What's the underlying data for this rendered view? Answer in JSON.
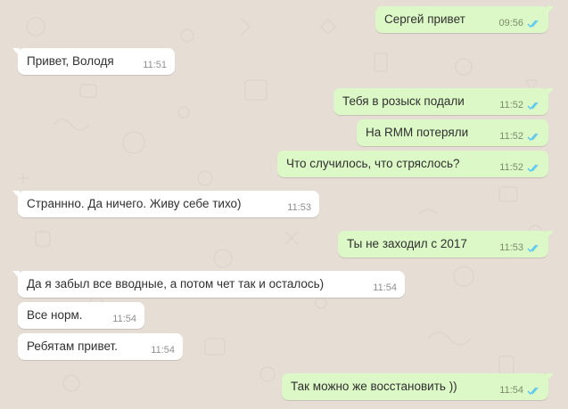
{
  "chat": {
    "messages": [
      {
        "direction": "out",
        "text": "Сергей привет",
        "time": "09:56",
        "status": "read-ticks-icon"
      },
      {
        "direction": "in",
        "text": "Привет, Володя",
        "time": "11:51"
      },
      {
        "direction": "out",
        "text": "Тебя в розыск подали",
        "time": "11:52",
        "status": "read-ticks-icon"
      },
      {
        "direction": "out",
        "text": "На RMM потеряли",
        "time": "11:52",
        "status": "read-ticks-icon"
      },
      {
        "direction": "out",
        "text": "Что случилось, что стряслось?",
        "time": "11:52",
        "status": "read-ticks-icon"
      },
      {
        "direction": "in",
        "text": "Страннно. Да ничего. Живу себе тихо)",
        "time": "11:53"
      },
      {
        "direction": "out",
        "text": "Ты не заходил с 2017",
        "time": "11:53",
        "status": "read-ticks-icon"
      },
      {
        "direction": "in",
        "text": "Да я забыл все вводные, а потом чет так и осталось)",
        "time": "11:54"
      },
      {
        "direction": "in",
        "text": "Все норм.",
        "time": "11:54"
      },
      {
        "direction": "in",
        "text": "Ребятам привет.",
        "time": "11:54"
      },
      {
        "direction": "out",
        "text": "Так можно же восстановить ))",
        "time": "11:54",
        "status": "read-ticks-icon"
      }
    ]
  },
  "colors": {
    "background": "#e6ded5",
    "incoming_bubble": "#ffffff",
    "outgoing_bubble": "#dcf8c6",
    "read_ticks": "#4fc3f7"
  }
}
